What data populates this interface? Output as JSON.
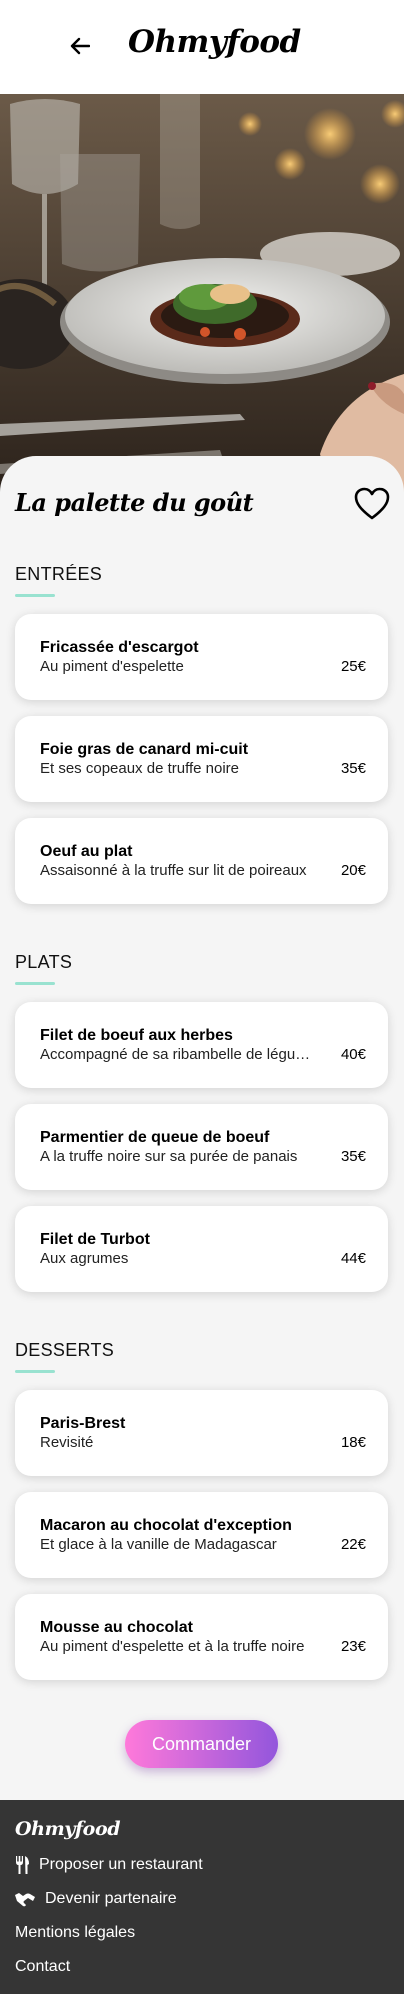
{
  "header": {
    "brand": "Ohmyfood",
    "back_icon": "arrow-left-icon"
  },
  "hero": {
    "image_alt": "Plated dish on a restaurant table"
  },
  "restaurant": {
    "name": "La palette du goût",
    "favorite_icon": "heart-outline-icon"
  },
  "sections": [
    {
      "title": "ENTRÉES",
      "dishes": [
        {
          "name": "Fricassée d'escargot",
          "description": "Au piment d'espelette",
          "price": "25€"
        },
        {
          "name": "Foie gras de canard mi-cuit",
          "description": "Et ses copeaux de truffe noire",
          "price": "35€"
        },
        {
          "name": "Oeuf au plat",
          "description": "Assaisonné à la truffe sur lit de poireaux",
          "price": "20€"
        }
      ]
    },
    {
      "title": "PLATS",
      "dishes": [
        {
          "name": "Filet de boeuf aux herbes",
          "description": "Accompagné de sa ribambelle de légumes",
          "price": "40€"
        },
        {
          "name": "Parmentier de queue de boeuf",
          "description": "A la truffe noire sur sa purée de panais",
          "price": "35€"
        },
        {
          "name": "Filet de Turbot",
          "description": "Aux agrumes",
          "price": "44€"
        }
      ]
    },
    {
      "title": "DESSERTS",
      "dishes": [
        {
          "name": "Paris-Brest",
          "description": "Revisité",
          "price": "18€"
        },
        {
          "name": "Macaron au chocolat d'exception",
          "description": "Et glace à la vanille de Madagascar",
          "price": "22€"
        },
        {
          "name": "Mousse au chocolat",
          "description": "Au piment d'espelette et à la truffe noire",
          "price": "23€"
        }
      ]
    }
  ],
  "order_button": {
    "label": "Commander"
  },
  "footer": {
    "brand": "Ohmyfood",
    "links": [
      {
        "label": "Proposer un restaurant",
        "icon": "utensils-icon"
      },
      {
        "label": "Devenir partenaire",
        "icon": "handshake-icon"
      },
      {
        "label": "Mentions légales"
      },
      {
        "label": "Contact"
      }
    ]
  },
  "colors": {
    "accent_underline": "#99e2d0",
    "button_gradient_start": "#ff79da",
    "button_gradient_end": "#9356dc",
    "footer_bg": "#353535",
    "page_bg": "#f5f5f5"
  }
}
